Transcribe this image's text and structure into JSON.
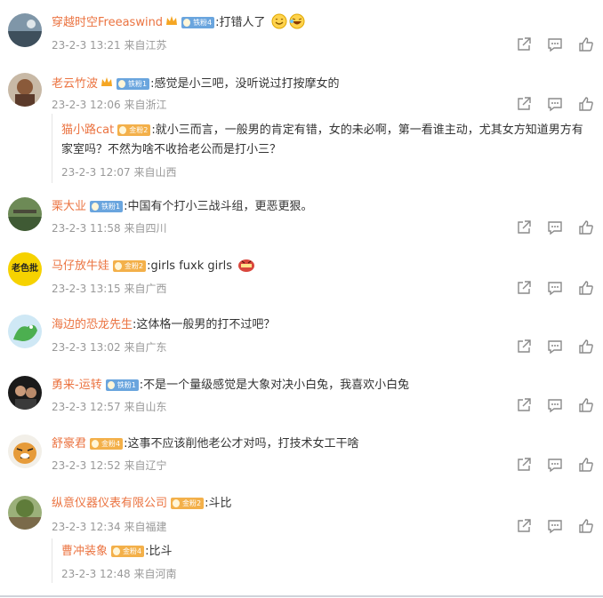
{
  "comments": [
    {
      "user": "穿越时空Freeaswind",
      "badge": "铁粉4",
      "badge_color": "blue",
      "text": ":打错人了",
      "emoji": [
        "smile-emoji",
        "laugh-emoji"
      ],
      "time": "23-2-3 13:21",
      "location": "来自江苏"
    },
    {
      "user": "老云竹波",
      "badge": "铁粉1",
      "badge_color": "blue",
      "text": ":感觉是小三吧，没听说过打按摩女的",
      "time": "23-2-3 12:06",
      "location": "来自浙江"
    },
    {
      "user": "栗大业",
      "badge": "铁粉1",
      "badge_color": "blue",
      "text": ":中国有个打小三战斗组，更恶更狠。",
      "time": "23-2-3 11:58",
      "location": "来自四川"
    },
    {
      "user": "马仔放牛娃",
      "badge": "金粉2",
      "badge_color": "gold",
      "text": ":girls fuxk girls",
      "emoji": [
        "angry-emoji"
      ],
      "time": "23-2-3 13:15",
      "location": "来自广西"
    },
    {
      "user": "海边的恐龙先生",
      "text": ":这体格一般男的打不过吧？",
      "time": "23-2-3 13:02",
      "location": "来自广东"
    },
    {
      "user": "勇来-运转",
      "badge": "铁粉1",
      "badge_color": "blue",
      "text": ":不是一个量级感觉是大象对决小白兔，我喜欢小白兔",
      "time": "23-2-3 12:57",
      "location": "来自山东"
    },
    {
      "user": "舒豪君",
      "badge": "金粉4",
      "badge_color": "gold",
      "text": ":这事不应该削他老公才对吗，打技术女工干啥",
      "time": "23-2-3 12:52",
      "location": "来自辽宁"
    },
    {
      "user": "纵意仪器仪表有限公司",
      "badge": "金粉2",
      "badge_color": "gold",
      "text": ":斗比",
      "time": "23-2-3 12:34",
      "location": "来自福建"
    }
  ],
  "replies": [
    {
      "user": "猫小路cat",
      "badge": "金粉2",
      "badge_color": "gold",
      "text": ":就小三而言，一般男的肯定有错，女的未必啊，第一看谁主动，尤其女方知道男方有家室吗？不然为啥不收拾老公而是打小三？",
      "time": "23-2-3 12:07",
      "location": "来自山西"
    },
    {
      "user": "曹冲装象",
      "badge": "金粉4",
      "badge_color": "gold",
      "text": ":比斗",
      "time": "23-2-3 12:48",
      "location": "来自河南"
    }
  ],
  "avatar_labels": {
    "c3": "老色批"
  },
  "actions": [
    "share-icon",
    "comment-icon",
    "like-icon"
  ],
  "colors": {
    "username": "#eb7340",
    "meta": "#999999",
    "iron_badge": "#6aa5de",
    "gold_badge": "#f3b04a"
  }
}
